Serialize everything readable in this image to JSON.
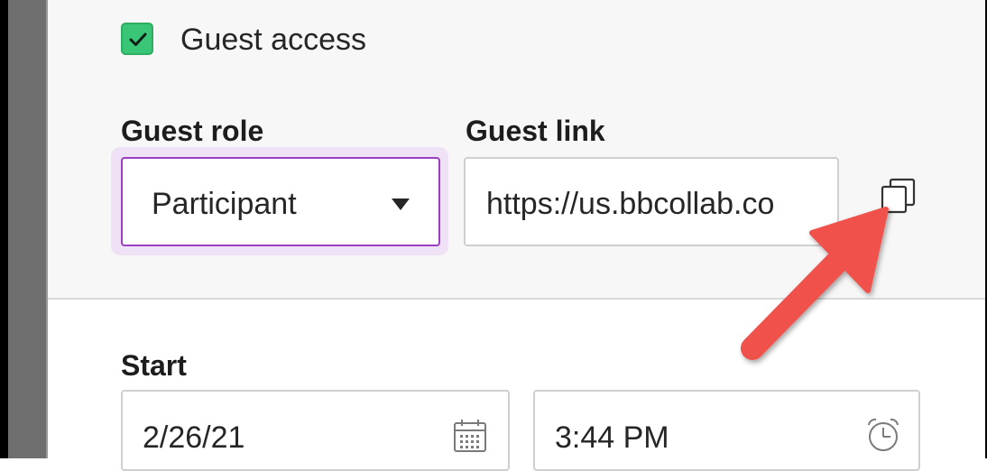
{
  "guest_access": {
    "label": "Guest access",
    "checked": true
  },
  "guest_role": {
    "label": "Guest role",
    "value": "Participant"
  },
  "guest_link": {
    "label": "Guest link",
    "value": "https://us.bbcollab.co"
  },
  "start": {
    "label": "Start",
    "date": "2/26/21",
    "time": "3:44 PM"
  },
  "icons": {
    "checkbox": "checkmark-icon",
    "dropdown": "caret-down-icon",
    "copy": "copy-icon",
    "date": "calendar-icon",
    "time": "alarm-clock-icon",
    "annotation": "arrow-annotation"
  },
  "colors": {
    "checkbox_green": "#39c676",
    "select_focus_purple": "#9a3fbf",
    "arrow_red": "#f0514c"
  }
}
